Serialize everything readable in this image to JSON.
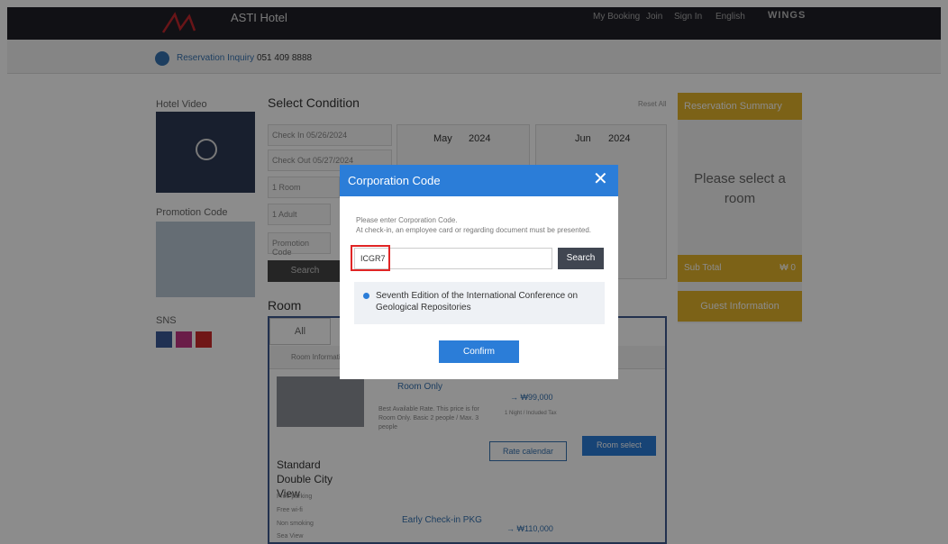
{
  "header": {
    "hotel_name": "ASTI Hotel",
    "nav": [
      "My Booking",
      "Join",
      "Sign In",
      "English",
      "WINGS"
    ]
  },
  "subbar": {
    "inquiry_label": "Reservation Inquiry",
    "phone": "051 409 8888"
  },
  "sidebar": {
    "hotel_video": "Hotel Video",
    "promotion_code": "Promotion Code",
    "sns": "SNS"
  },
  "condition": {
    "title": "Select Condition",
    "reset": "Reset All",
    "check_in_label": "Check In",
    "check_in_value": "05/26/2024",
    "check_out_label": "Check Out",
    "check_out_value": "05/27/2024",
    "rooms": "1 Room",
    "adults": "1 Adult",
    "promo_placeholder": "Promotion Code",
    "search": "Search",
    "cal_left_month": "May",
    "cal_left_year": "2024",
    "cal_right_month": "Jun",
    "cal_right_year": "2024"
  },
  "summary": {
    "title": "Reservation Summary",
    "please": "Please select a room",
    "subtotal_label": "Sub Total",
    "subtotal_value": "₩ 0",
    "guest_info": "Guest Information"
  },
  "room": {
    "title": "Room",
    "tab_all": "All",
    "col_info": "Room Information",
    "room_name": "Standard Double City View",
    "amenities": [
      "Free parking",
      "Free wi-fi",
      "Non smoking",
      "Sea View"
    ],
    "plan1": "Room Only",
    "plan1_price": "→ ₩99,000",
    "plan1_tax": "1 Night / Included Tax",
    "plan1_desc": "Best Available Rate. This price is for Room Only. Basic 2 people / Max. 3 people",
    "rate_calendar": "Rate calendar",
    "room_select": "Room select",
    "plan2": "Early Check-in PKG",
    "plan2_price": "→ ₩110,000"
  },
  "modal": {
    "title": "Corporation Code",
    "desc_line1": "Please enter Corporation Code.",
    "desc_line2": "At check-in, an employee card or regarding document must be presented.",
    "code_value": "ICGR7",
    "search": "Search",
    "result": "Seventh Edition of the International Conference on Geological Repositories",
    "confirm": "Confirm"
  }
}
